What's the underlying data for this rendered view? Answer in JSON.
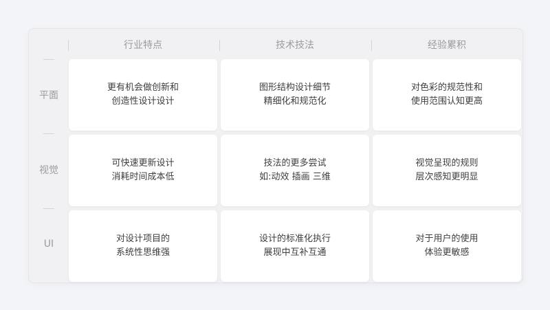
{
  "columns": [
    "行业特点",
    "技术技法",
    "经验累积"
  ],
  "rows": [
    {
      "label": "平面",
      "cells": [
        [
          "更有机会做创新和",
          "创造性设计设计"
        ],
        [
          "图形结构设计细节",
          "精细化和规范化"
        ],
        [
          "对色彩的规范性和",
          "使用范围认知更高"
        ]
      ]
    },
    {
      "label": "视觉",
      "cells": [
        [
          "可快速更新设计",
          "消耗时间成本低"
        ],
        [
          "技法的更多尝试",
          "如:动效 插画 三维"
        ],
        [
          "视觉呈现的规则",
          "层次感知更明显"
        ]
      ]
    },
    {
      "label": "UI",
      "cells": [
        [
          "对设计项目的",
          "系统性思维强"
        ],
        [
          "设计的标准化执行",
          "展现中互补互通"
        ],
        [
          "对于用户的使用",
          "体验更敏感"
        ]
      ]
    }
  ]
}
